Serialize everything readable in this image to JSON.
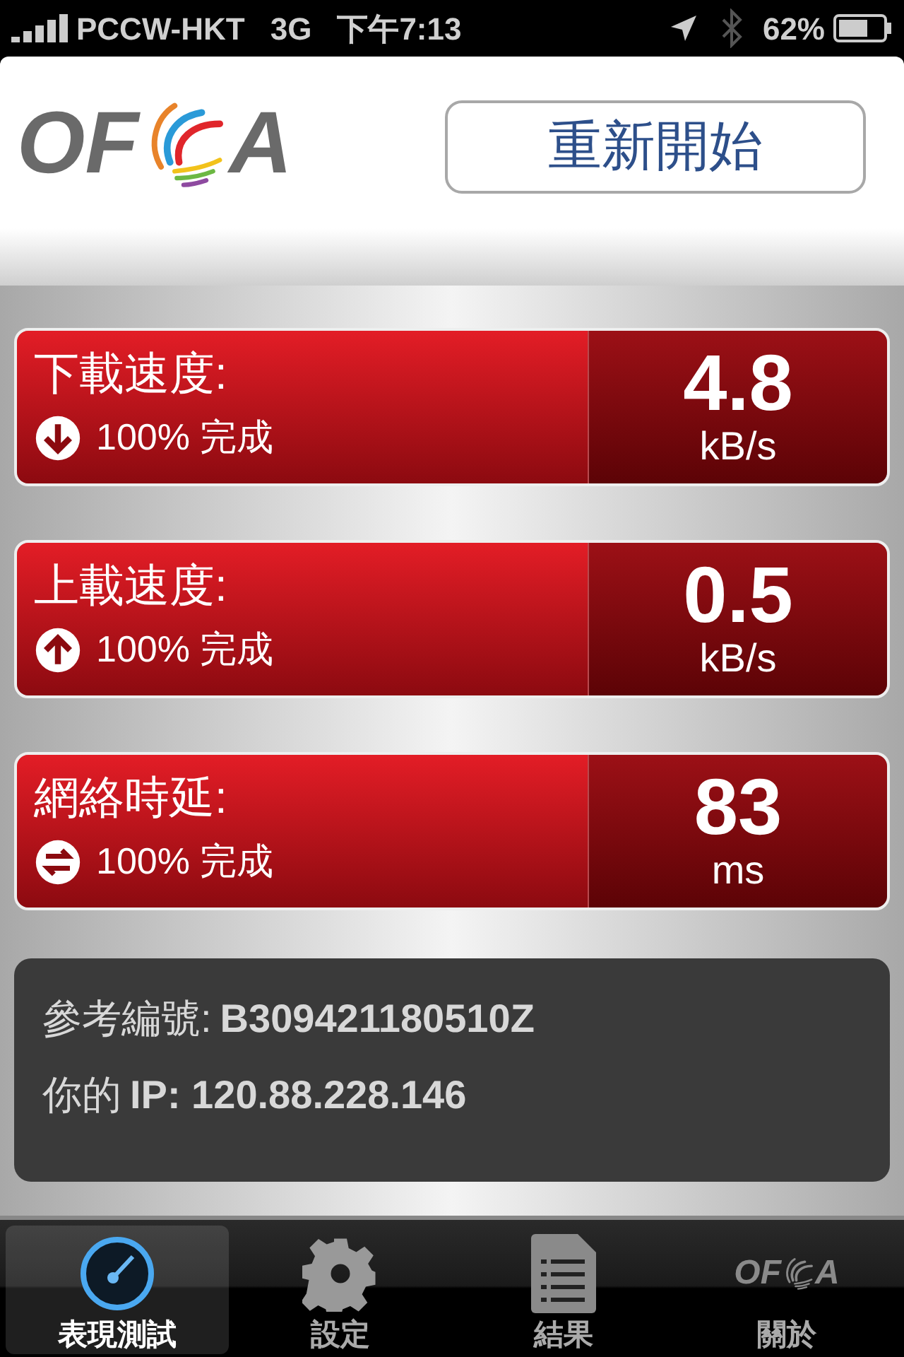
{
  "status_bar": {
    "carrier": "PCCW-HKT",
    "network": "3G",
    "time": "下午7:13",
    "battery": "62%"
  },
  "header": {
    "logo": {
      "before": "OF",
      "after": "A"
    },
    "restart_button": "重新開始"
  },
  "metrics": [
    {
      "kind": "download",
      "label": "下載速度:",
      "progress": "100% 完成",
      "value": "4.8",
      "unit": "kB/s"
    },
    {
      "kind": "upload",
      "label": "上載速度:",
      "progress": "100% 完成",
      "value": "0.5",
      "unit": "kB/s"
    },
    {
      "kind": "latency",
      "label": "網絡時延:",
      "progress": "100% 完成",
      "value": "83",
      "unit": "ms"
    }
  ],
  "info": [
    {
      "label": "參考編號:",
      "value": "B309421180510Z"
    },
    {
      "label": "你的",
      "value": "IP: 120.88.228.146"
    }
  ],
  "tabs": [
    {
      "kind": "gauge",
      "label": "表現測試",
      "selected": true
    },
    {
      "kind": "gear",
      "label": "設定",
      "selected": false
    },
    {
      "kind": "document",
      "label": "結果",
      "selected": false
    },
    {
      "kind": "logo",
      "label": "關於",
      "selected": false,
      "logo": {
        "before": "OF",
        "after": "A"
      }
    }
  ]
}
